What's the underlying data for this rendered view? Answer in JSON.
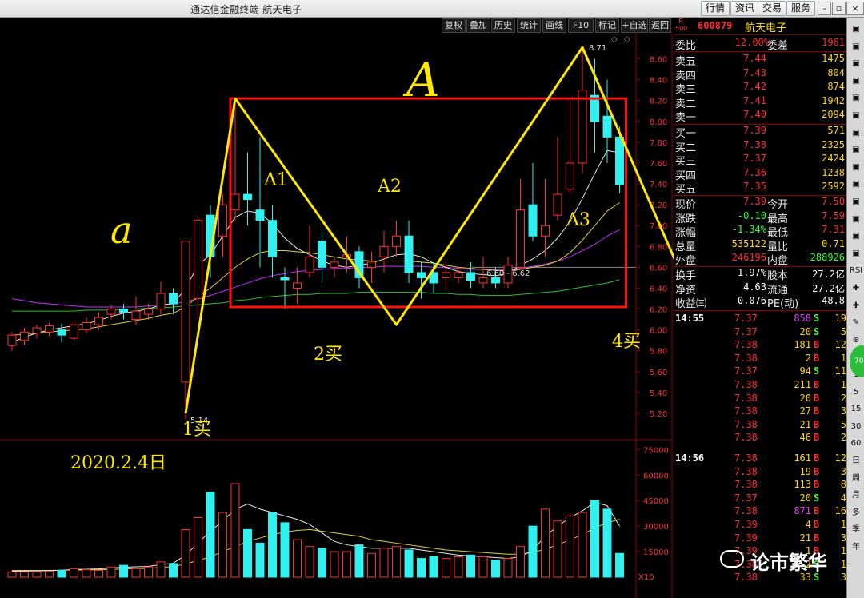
{
  "app": {
    "title": "通达信金融终端  航天电子"
  },
  "menu": [
    "行情",
    "资讯",
    "交易",
    "服务"
  ],
  "window_controls": [
    "-",
    "▫",
    "×"
  ],
  "chart_toolbar": [
    "复权",
    "叠加",
    "历史",
    "统计",
    "画线",
    "F10",
    "标记",
    "+自选",
    "返回"
  ],
  "stock": {
    "code": "600879",
    "name": "航天电子",
    "badge_top": "R",
    "badge_bottom": "500"
  },
  "quote": {
    "weibi_label": "委比",
    "weibi": "12.00%",
    "weicha_label": "委差",
    "weicha": "1961",
    "asks": [
      {
        "label": "卖五",
        "price": "7.44",
        "vol": "1475"
      },
      {
        "label": "卖四",
        "price": "7.43",
        "vol": "804"
      },
      {
        "label": "卖三",
        "price": "7.42",
        "vol": "874"
      },
      {
        "label": "卖二",
        "price": "7.41",
        "vol": "1942"
      },
      {
        "label": "卖一",
        "price": "7.40",
        "vol": "2094"
      }
    ],
    "bids": [
      {
        "label": "买一",
        "price": "7.39",
        "vol": "571"
      },
      {
        "label": "买二",
        "price": "7.38",
        "vol": "2325"
      },
      {
        "label": "买三",
        "price": "7.37",
        "vol": "2424"
      },
      {
        "label": "买四",
        "price": "7.36",
        "vol": "1238"
      },
      {
        "label": "买五",
        "price": "7.35",
        "vol": "2592"
      }
    ],
    "stats": [
      {
        "l1": "现价",
        "v1": "7.39",
        "c1": "#ff3030",
        "l2": "今开",
        "v2": "7.50",
        "c2": "#ff3030"
      },
      {
        "l1": "涨跌",
        "v1": "-0.10",
        "c1": "#30ff30",
        "l2": "最高",
        "v2": "7.59",
        "c2": "#ff3030"
      },
      {
        "l1": "涨幅",
        "v1": "-1.34%",
        "c1": "#30ff30",
        "l2": "最低",
        "v2": "7.31",
        "c2": "#ff3030"
      },
      {
        "l1": "总量",
        "v1": "535122",
        "c1": "#ffd800",
        "l2": "量比",
        "v2": "0.71",
        "c2": "#ffd800"
      },
      {
        "l1": "外盘",
        "v1": "246196",
        "c1": "#ff3030",
        "l2": "内盘",
        "v2": "288926",
        "c2": "#30ff30"
      }
    ],
    "fin": [
      {
        "l1": "换手",
        "v1": "1.97%",
        "l2": "股本",
        "v2": "27.2亿"
      },
      {
        "l1": "净资",
        "v1": "4.63",
        "l2": "流通",
        "v2": "27.2亿"
      },
      {
        "l1": "收益㈢",
        "v1": "0.076",
        "l2": "PE(动)",
        "v2": "48.8"
      }
    ]
  },
  "ticks": [
    {
      "time": "14:55",
      "price": "7.37",
      "vol": "858",
      "side": "S",
      "num": "19",
      "vcolor": "#e040ff"
    },
    {
      "time": "",
      "price": "7.37",
      "vol": "20",
      "side": "S",
      "num": "5"
    },
    {
      "time": "",
      "price": "7.38",
      "vol": "181",
      "side": "B",
      "num": "12"
    },
    {
      "time": "",
      "price": "7.38",
      "vol": "2",
      "side": "B",
      "num": "1"
    },
    {
      "time": "",
      "price": "7.37",
      "vol": "94",
      "side": "S",
      "num": "11"
    },
    {
      "time": "",
      "price": "7.38",
      "vol": "211",
      "side": "B",
      "num": "1"
    },
    {
      "time": "",
      "price": "7.38",
      "vol": "20",
      "side": "B",
      "num": "2"
    },
    {
      "time": "",
      "price": "7.38",
      "vol": "27",
      "side": "B",
      "num": "3"
    },
    {
      "time": "",
      "price": "7.38",
      "vol": "21",
      "side": "B",
      "num": "5"
    },
    {
      "time": "",
      "price": "7.38",
      "vol": "46",
      "side": "B",
      "num": "2"
    },
    {
      "time": "14:56",
      "price": "7.38",
      "vol": "161",
      "side": "B",
      "num": "12"
    },
    {
      "time": "",
      "price": "7.38",
      "vol": "19",
      "side": "B",
      "num": "3"
    },
    {
      "time": "",
      "price": "7.38",
      "vol": "113",
      "side": "B",
      "num": "8"
    },
    {
      "time": "",
      "price": "7.37",
      "vol": "20",
      "side": "S",
      "num": "4"
    },
    {
      "time": "",
      "price": "7.38",
      "vol": "871",
      "side": "B",
      "num": "16",
      "vcolor": "#e040ff"
    },
    {
      "time": "",
      "price": "7.39",
      "vol": "4",
      "side": "B",
      "num": "1"
    },
    {
      "time": "",
      "price": "7.39",
      "vol": "21",
      "side": "B",
      "num": "3"
    },
    {
      "time": "",
      "price": "7.39",
      "vol": "1",
      "side": "B",
      "num": "1"
    },
    {
      "time": "",
      "price": "7.38",
      "vol": "2",
      "side": "S",
      "num": "1"
    },
    {
      "time": "",
      "price": "7.38",
      "vol": "33",
      "side": "S",
      "num": "3"
    }
  ],
  "right_strip": [
    "▣",
    "▣",
    "▣",
    "▣",
    "▣",
    "▣",
    "▣",
    "▣",
    "▣",
    "▣",
    "▣",
    "▣",
    "▣",
    "▣",
    "RSI",
    "✚",
    "✚",
    "✎",
    "⊕",
    "⊕",
    "1",
    "5",
    "15",
    "30",
    "60",
    "日",
    "周",
    "月",
    "多",
    "季",
    "年"
  ],
  "live_badge": "70",
  "watermark": "论市繁华",
  "annotations": {
    "big_a": "A",
    "small_a": "a",
    "a1": "A1",
    "a2": "A2",
    "a3": "A3",
    "buy1": "1买",
    "buy2": "2买",
    "buy4": "4买",
    "date": "2020.2.4日"
  },
  "chart_data": [
    {
      "type": "candlestick",
      "y_axis_ticks": [
        "8.60",
        "8.40",
        "8.20",
        "8.00",
        "7.80",
        "7.60",
        "7.40",
        "7.20",
        "7.00",
        "6.80",
        "6.60",
        "6.40",
        "6.20",
        "6.00",
        "5.80",
        "5.60",
        "5.40",
        "5.20"
      ],
      "ylim": [
        5.1,
        8.75
      ],
      "max_label": "8.71",
      "min_label": "5.14",
      "range_label": "6.60 - 6.62",
      "box": {
        "x_start": 18,
        "x_end": 46,
        "y_top": 8.22,
        "y_bottom": 6.22
      },
      "zigzag": [
        {
          "i": 14,
          "v": 5.2
        },
        {
          "i": 18,
          "v": 8.22
        },
        {
          "i": 31,
          "v": 6.05
        },
        {
          "i": 46,
          "v": 8.71
        },
        {
          "i": 55,
          "v": 6.25
        }
      ],
      "candles": [
        [
          5.85,
          5.95,
          5.98,
          5.8
        ],
        [
          5.9,
          5.98,
          6.02,
          5.85
        ],
        [
          5.97,
          6.02,
          6.05,
          5.92
        ],
        [
          5.98,
          6.04,
          6.07,
          5.94
        ],
        [
          6.0,
          5.95,
          6.06,
          5.88
        ],
        [
          5.92,
          6.05,
          6.09,
          5.9
        ],
        [
          6.0,
          6.07,
          6.12,
          5.97
        ],
        [
          6.05,
          6.12,
          6.17,
          6.0
        ],
        [
          6.15,
          6.2,
          6.24,
          6.1
        ],
        [
          6.2,
          6.17,
          6.25,
          6.1
        ],
        [
          6.1,
          6.18,
          6.32,
          6.05
        ],
        [
          6.15,
          6.2,
          6.25,
          6.1
        ],
        [
          6.2,
          6.35,
          6.46,
          6.15
        ],
        [
          6.35,
          6.25,
          6.4,
          6.15
        ],
        [
          5.5,
          6.85,
          6.85,
          5.14
        ],
        [
          6.3,
          7.05,
          7.1,
          6.1
        ],
        [
          7.1,
          6.7,
          7.2,
          6.5
        ],
        [
          6.9,
          7.2,
          7.3,
          6.7
        ],
        [
          7.15,
          7.3,
          8.2,
          7.05
        ],
        [
          7.3,
          7.25,
          7.7,
          7.0
        ],
        [
          7.15,
          7.05,
          7.85,
          6.6
        ],
        [
          7.05,
          6.7,
          7.2,
          6.5
        ],
        [
          6.5,
          6.48,
          6.6,
          6.2
        ],
        [
          6.4,
          6.45,
          6.6,
          6.25
        ],
        [
          6.55,
          6.7,
          7.0,
          6.5
        ],
        [
          6.85,
          6.6,
          6.95,
          6.45
        ],
        [
          6.6,
          6.65,
          6.7,
          6.5
        ],
        [
          6.7,
          6.72,
          6.9,
          6.55
        ],
        [
          6.75,
          6.5,
          6.8,
          6.4
        ],
        [
          6.6,
          6.65,
          6.75,
          6.45
        ],
        [
          6.7,
          6.8,
          6.95,
          6.55
        ],
        [
          6.8,
          6.9,
          7.05,
          6.7
        ],
        [
          6.9,
          6.55,
          7.05,
          6.45
        ],
        [
          6.55,
          6.5,
          6.65,
          6.3
        ],
        [
          6.55,
          6.45,
          6.65,
          6.35
        ],
        [
          6.5,
          6.55,
          6.65,
          6.4
        ],
        [
          6.5,
          6.55,
          6.6,
          6.45
        ],
        [
          6.55,
          6.47,
          6.65,
          6.4
        ],
        [
          6.45,
          6.5,
          6.7,
          6.4
        ],
        [
          6.5,
          6.45,
          6.6,
          6.4
        ],
        [
          6.45,
          6.62,
          6.7,
          6.4
        ],
        [
          6.6,
          7.15,
          7.45,
          6.6
        ],
        [
          7.2,
          6.9,
          7.6,
          6.85
        ],
        [
          6.9,
          7.0,
          7.45,
          6.7
        ],
        [
          7.1,
          7.3,
          7.85,
          7.05
        ],
        [
          7.35,
          7.6,
          8.2,
          7.3
        ],
        [
          7.6,
          8.3,
          8.71,
          7.5
        ],
        [
          8.25,
          8.0,
          8.6,
          7.7
        ],
        [
          8.05,
          7.85,
          8.4,
          7.6
        ],
        [
          7.85,
          7.39,
          7.95,
          7.31
        ]
      ],
      "ma_fast": [
        5.88,
        5.93,
        5.97,
        6.0,
        6.02,
        6.04,
        6.06,
        6.09,
        6.13,
        6.16,
        6.18,
        6.2,
        6.24,
        6.25,
        6.4,
        6.62,
        6.72,
        6.9,
        7.08,
        7.14,
        7.12,
        7.02,
        6.88,
        6.78,
        6.72,
        6.66,
        6.62,
        6.6,
        6.62,
        6.64,
        6.68,
        6.72,
        6.73,
        6.7,
        6.64,
        6.6,
        6.56,
        6.54,
        6.53,
        6.52,
        6.54,
        6.62,
        6.68,
        6.76,
        6.88,
        7.04,
        7.26,
        7.5,
        7.72,
        7.7
      ],
      "ma_mid": [
        5.95,
        5.96,
        5.97,
        5.98,
        5.99,
        6.0,
        6.01,
        6.03,
        6.05,
        6.07,
        6.09,
        6.11,
        6.14,
        6.16,
        6.22,
        6.32,
        6.4,
        6.5,
        6.6,
        6.68,
        6.74,
        6.76,
        6.76,
        6.75,
        6.74,
        6.72,
        6.7,
        6.68,
        6.67,
        6.66,
        6.66,
        6.66,
        6.66,
        6.65,
        6.64,
        6.62,
        6.6,
        6.59,
        6.58,
        6.57,
        6.57,
        6.58,
        6.6,
        6.62,
        6.66,
        6.74,
        6.86,
        7.0,
        7.14,
        7.22
      ],
      "ma_slow": [
        6.3,
        6.28,
        6.26,
        6.25,
        6.24,
        6.23,
        6.22,
        6.22,
        6.22,
        6.22,
        6.22,
        6.23,
        6.24,
        6.25,
        6.27,
        6.3,
        6.33,
        6.37,
        6.41,
        6.45,
        6.49,
        6.52,
        6.54,
        6.56,
        6.57,
        6.58,
        6.59,
        6.59,
        6.6,
        6.6,
        6.61,
        6.61,
        6.61,
        6.61,
        6.6,
        6.6,
        6.59,
        6.58,
        6.58,
        6.58,
        6.58,
        6.59,
        6.61,
        6.63,
        6.66,
        6.7,
        6.76,
        6.82,
        6.9,
        6.96
      ],
      "ma_long": [
        6.18,
        6.18,
        6.18,
        6.18,
        6.18,
        6.18,
        6.19,
        6.19,
        6.19,
        6.2,
        6.2,
        6.21,
        6.21,
        6.22,
        6.23,
        6.24,
        6.25,
        6.26,
        6.28,
        6.29,
        6.31,
        6.32,
        6.33,
        6.34,
        6.34,
        6.35,
        6.35,
        6.35,
        6.36,
        6.36,
        6.36,
        6.36,
        6.36,
        6.36,
        6.35,
        6.35,
        6.34,
        6.34,
        6.33,
        6.33,
        6.33,
        6.34,
        6.35,
        6.36,
        6.37,
        6.39,
        6.41,
        6.43,
        6.45,
        6.48
      ]
    },
    {
      "type": "bar",
      "y_axis_ticks": [
        "75000",
        "60000",
        "45000",
        "30000",
        "15000"
      ],
      "ylim": [
        0,
        78000
      ],
      "corner_label": "X10",
      "values": [
        3000,
        3000,
        3000,
        3500,
        4000,
        5000,
        4500,
        4000,
        6000,
        7000,
        5000,
        6000,
        9000,
        8000,
        28000,
        35000,
        50000,
        38000,
        55000,
        28000,
        20000,
        38000,
        32000,
        22000,
        18000,
        17000,
        15000,
        15000,
        19000,
        14000,
        17000,
        18000,
        16000,
        11000,
        12000,
        11000,
        12000,
        13000,
        12000,
        10000,
        11000,
        18000,
        30000,
        40000,
        33000,
        36000,
        38000,
        45000,
        40000,
        14000
      ],
      "ma_fast": [
        3500,
        3600,
        3700,
        3800,
        4100,
        4500,
        4700,
        4900,
        5400,
        5900,
        6100,
        6400,
        7400,
        8200,
        13000,
        20000,
        27000,
        33000,
        40000,
        43000,
        40000,
        38000,
        36000,
        34000,
        31000,
        26000,
        21000,
        19000,
        18000,
        17000,
        17000,
        17000,
        17000,
        16000,
        15000,
        14000,
        13000,
        12500,
        12000,
        11500,
        11000,
        12000,
        16000,
        24000,
        30000,
        35000,
        39000,
        44000,
        42000,
        30000
      ],
      "ma_slow": [
        4000,
        4000,
        4000,
        4000,
        4100,
        4200,
        4300,
        4400,
        4600,
        4800,
        5000,
        5300,
        5700,
        6200,
        7800,
        9800,
        12000,
        15000,
        18000,
        21000,
        23000,
        25000,
        26500,
        27500,
        28000,
        27000,
        26000,
        25000,
        24000,
        22000,
        21000,
        20000,
        19000,
        18000,
        17000,
        16000,
        15500,
        15000,
        14500,
        14000,
        13500,
        13500,
        14500,
        16500,
        19000,
        22000,
        25000,
        29000,
        32000,
        34000
      ]
    }
  ]
}
